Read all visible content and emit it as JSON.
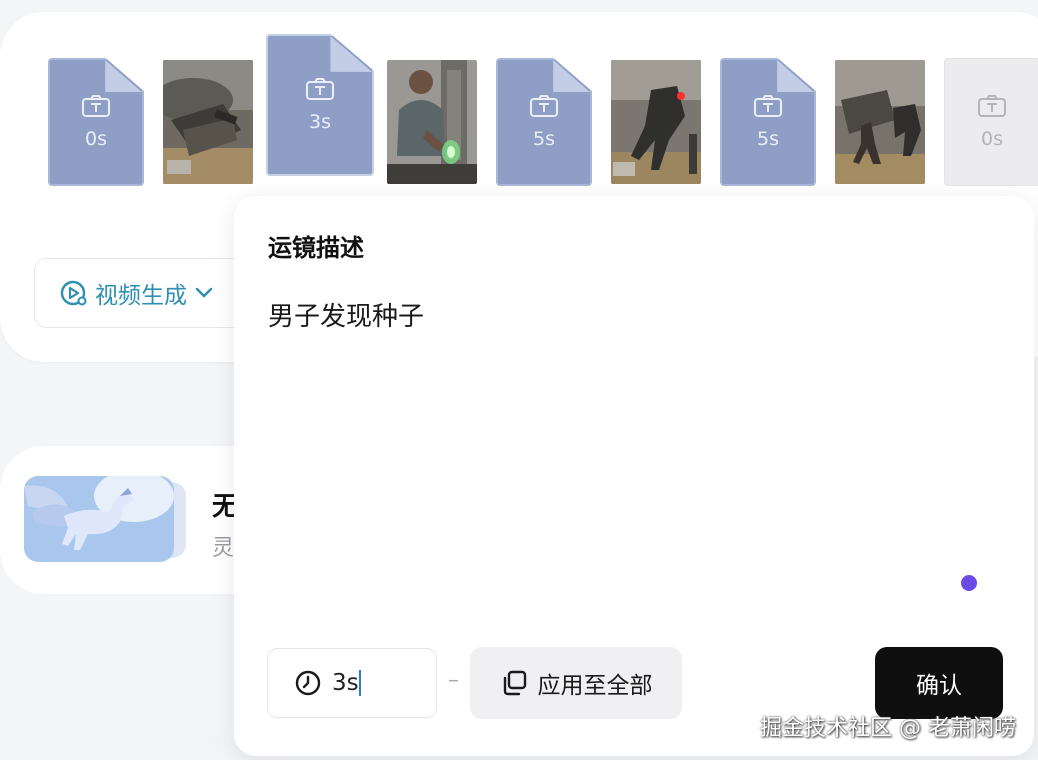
{
  "timeline": {
    "slots": [
      {
        "duration": "0s"
      },
      {
        "duration": "3s"
      },
      {
        "duration": "5s"
      },
      {
        "duration": "5s"
      },
      {
        "duration": "0s"
      }
    ],
    "shots": [
      {
        "content": "ruined-vehicle-scene"
      },
      {
        "content": "man-finding-seed-scene"
      },
      {
        "content": "robot-battle-scene"
      },
      {
        "content": "soldier-vs-robot-scene"
      }
    ]
  },
  "mode_selector": {
    "label": "视频生成",
    "icon": "video-play-icon"
  },
  "project_card": {
    "title": "无",
    "subtitle": "灵"
  },
  "camera_popover": {
    "title": "运镜描述",
    "description": "男子发现种子",
    "duration_value": "3s",
    "apply_all_label": "应用至全部",
    "confirm_label": "确认",
    "accent_dot_color": "#6b4be6"
  },
  "watermark": "掘金技术社区 @ 老萧闲唠",
  "colors": {
    "slot_fill": "#8f9ec4",
    "mode_accent": "#2e8fb0",
    "confirm_bg": "#0f0f10"
  }
}
